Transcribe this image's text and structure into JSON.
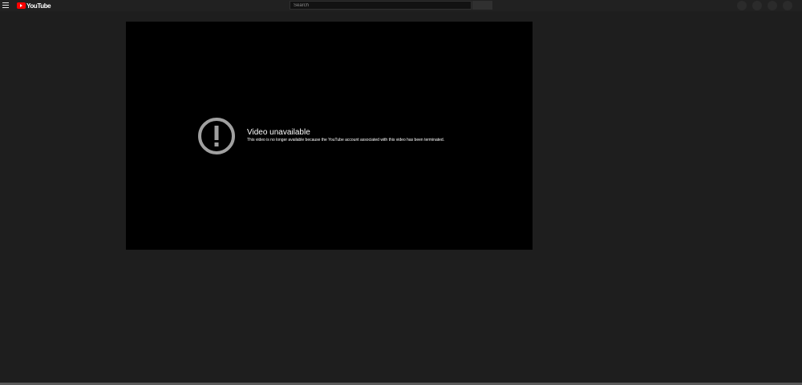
{
  "app": {
    "logo_text": "YouTube",
    "brand_color": "#ff0000"
  },
  "header": {
    "menu_icon": "hamburger-menu-icon",
    "search": {
      "placeholder": "Search",
      "value": ""
    }
  },
  "player": {
    "error_icon": "exclamation-circle-icon",
    "error_title": "Video unavailable",
    "error_reason": "This video is no longer available because the YouTube account associated with this video has been terminated."
  }
}
